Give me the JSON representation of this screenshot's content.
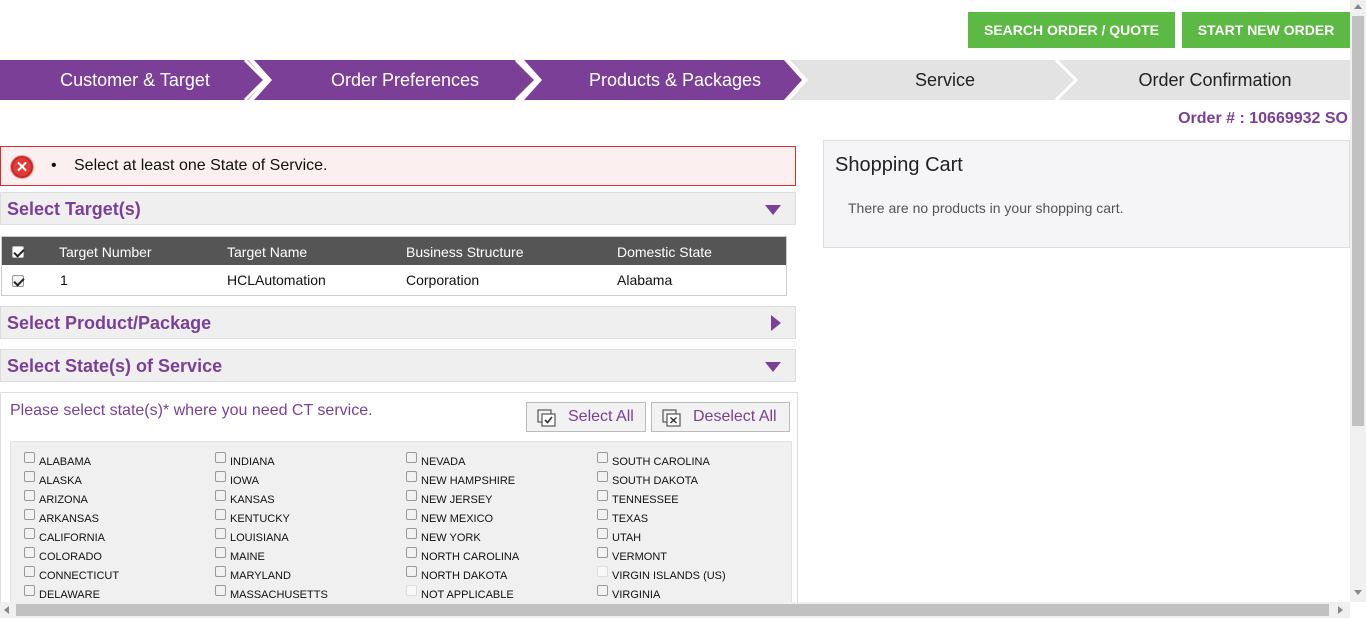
{
  "header": {
    "search_button": "SEARCH ORDER / QUOTE",
    "new_order_button": "START NEW ORDER"
  },
  "steps": [
    {
      "label": "Customer & Target",
      "state": "done"
    },
    {
      "label": "Order Preferences",
      "state": "done"
    },
    {
      "label": "Products & Packages",
      "state": "active"
    },
    {
      "label": "Service",
      "state": "todo"
    },
    {
      "label": "Order Confirmation",
      "state": "todo"
    }
  ],
  "order": {
    "number": "Order # : 10669932 SO"
  },
  "alert": {
    "message": "Select at least one State of Service.",
    "icon": "error-x-icon"
  },
  "sections": {
    "targets": "Select Target(s)",
    "product": "Select Product/Package",
    "states": "Select State(s) of Service"
  },
  "target_table": {
    "columns": [
      "Target Number",
      "Target Name",
      "Business Structure",
      "Domestic State"
    ],
    "rows": [
      {
        "checked": true,
        "number": "1",
        "name": "HCLAutomation",
        "structure": "Corporation",
        "state": "Alabama"
      }
    ]
  },
  "cart": {
    "title": "Shopping Cart",
    "empty_text": "There are no products in your shopping cart."
  },
  "states_panel": {
    "prompt": "Please select state(s)* where you need CT service.",
    "select_all": "Select All",
    "deselect_all": "Deselect All",
    "columns": [
      [
        "ALABAMA",
        "ALASKA",
        "ARIZONA",
        "ARKANSAS",
        "CALIFORNIA",
        "COLORADO",
        "CONNECTICUT",
        "DELAWARE"
      ],
      [
        "INDIANA",
        "IOWA",
        "KANSAS",
        "KENTUCKY",
        "LOUISIANA",
        "MAINE",
        "MARYLAND",
        "MASSACHUSETTS"
      ],
      [
        "NEVADA",
        "NEW HAMPSHIRE",
        "NEW JERSEY",
        "NEW MEXICO",
        "NEW YORK",
        "NORTH CAROLINA",
        "NORTH DAKOTA",
        "NOT APPLICABLE"
      ],
      [
        "SOUTH CAROLINA",
        "SOUTH DAKOTA",
        "TENNESSEE",
        "TEXAS",
        "UTAH",
        "VERMONT",
        "VIRGIN ISLANDS (US)",
        "VIRGINIA"
      ]
    ],
    "disabled": [
      "NOT APPLICABLE",
      "VIRGIN ISLANDS (US)"
    ]
  },
  "colors": {
    "brand_purple": "#7b3f98",
    "button_green": "#5cb944",
    "step_todo": "#e3e3e3",
    "error_red": "#d32f2f"
  }
}
